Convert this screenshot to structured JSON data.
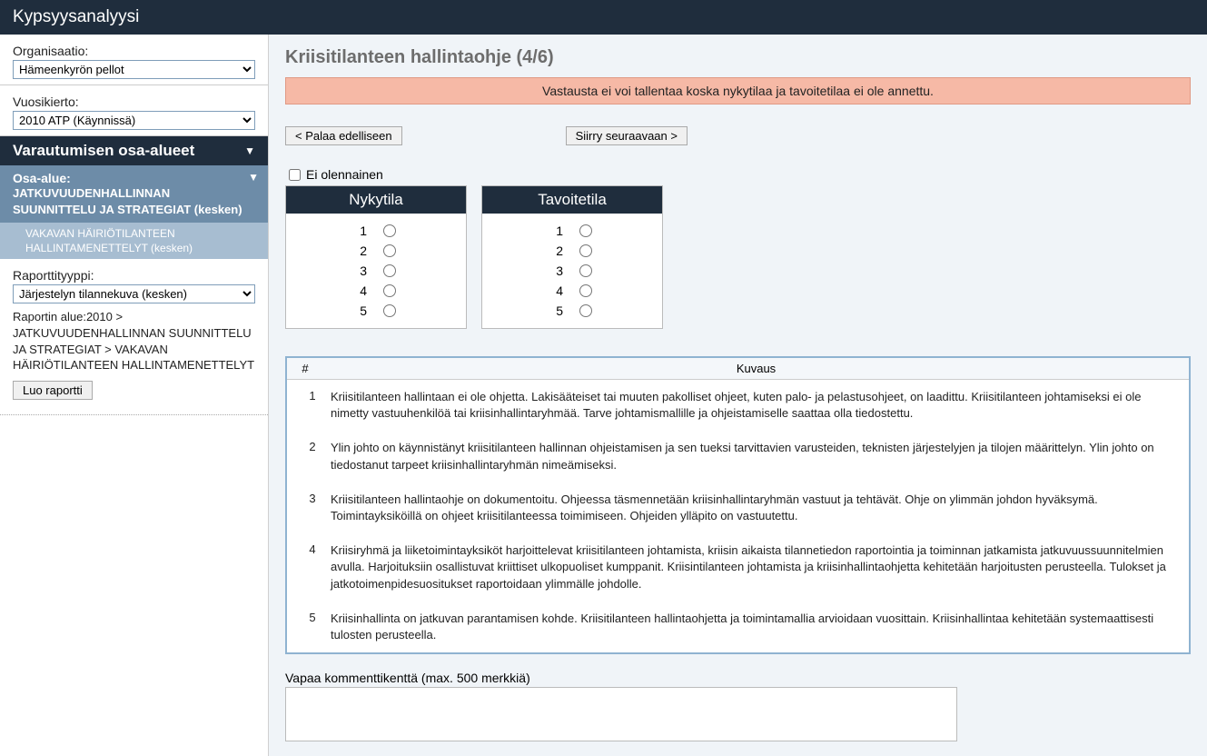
{
  "app_title": "Kypsyysanalyysi",
  "sidebar": {
    "org_label": "Organisaatio:",
    "org_value": "Hämeenkyrön pellot",
    "cycle_label": "Vuosikierto:",
    "cycle_value": "2010 ATP (Käynnissä)",
    "areas_header": "Varautumisen osa-alueet",
    "osa_label": "Osa-alue:",
    "osa_text": "JATKUVUUDENHALLINNAN SUUNNITTELU JA STRATEGIAT (kesken)",
    "osa_sub": "VAKAVAN HÄIRIÖTILANTEEN HALLINTAMENETTELYT (kesken)",
    "report_type_label": "Raporttityyppi:",
    "report_type_value": "Järjestelyn tilannekuva (kesken)",
    "report_area_label": "Raportin alue:",
    "report_breadcrumb": "2010 > JATKUVUUDENHALLINNAN SUUNNITTELU JA STRATEGIAT > VAKAVAN HÄIRIÖTILANTEEN HALLINTAMENETTELYT",
    "create_report": "Luo raportti"
  },
  "main": {
    "title": "Kriisitilanteen hallintaohje (4/6)",
    "alert": "Vastausta ei voi tallentaa koska nykytilaa ja tavoitetilaa ei ole annettu.",
    "prev": "< Palaa edelliseen",
    "next": "Siirry seuraavaan >",
    "not_relevant": "Ei olennainen",
    "col_current": "Nykytila",
    "col_target": "Tavoitetila",
    "levels": [
      "1",
      "2",
      "3",
      "4",
      "5"
    ],
    "desc_h_num": "#",
    "desc_h_txt": "Kuvaus",
    "descriptions": [
      {
        "n": "1",
        "t": "Kriisitilanteen hallintaan ei ole ohjetta. Lakisääteiset tai muuten pakolliset ohjeet, kuten palo- ja pelastusohjeet, on laadittu. Kriisitilanteen johtamiseksi ei ole nimetty vastuuhenkilöä tai kriisinhallintaryhmää. Tarve johtamismallille ja ohjeistamiselle saattaa olla tiedostettu."
      },
      {
        "n": "2",
        "t": "Ylin johto on käynnistänyt kriisitilanteen hallinnan ohjeistamisen ja sen tueksi tarvittavien varusteiden, teknisten järjestelyjen ja tilojen määrittelyn. Ylin johto on tiedostanut tarpeet kriisinhallintaryhmän nimeämiseksi."
      },
      {
        "n": "3",
        "t": "Kriisitilanteen hallintaohje on dokumentoitu. Ohjeessa täsmennetään kriisinhallintaryhmän vastuut ja tehtävät. Ohje on ylimmän johdon hyväksymä. Toimintayksiköillä on ohjeet kriisitilanteessa toimimiseen. Ohjeiden ylläpito on vastuutettu."
      },
      {
        "n": "4",
        "t": "Kriisiryhmä ja liiketoimintayksiköt harjoittelevat kriisitilanteen johtamista, kriisin aikaista tilannetiedon raportointia ja toiminnan jatkamista jatkuvuussuunnitelmien avulla. Harjoituksiin osallistuvat kriittiset ulkopuoliset kumppanit. Kriisintilanteen johtamista ja kriisinhallintaohjetta kehitetään harjoitusten perusteella. Tulokset ja jatkotoimenpidesuositukset raportoidaan ylimmälle johdolle."
      },
      {
        "n": "5",
        "t": "Kriisinhallinta on jatkuvan parantamisen kohde. Kriisitilanteen hallintaohjetta ja toimintamallia arvioidaan vuosittain. Kriisinhallintaa kehitetään systemaattisesti tulosten perusteella."
      }
    ],
    "comment_label": "Vapaa kommenttikenttä (max. 500 merkkiä)"
  }
}
